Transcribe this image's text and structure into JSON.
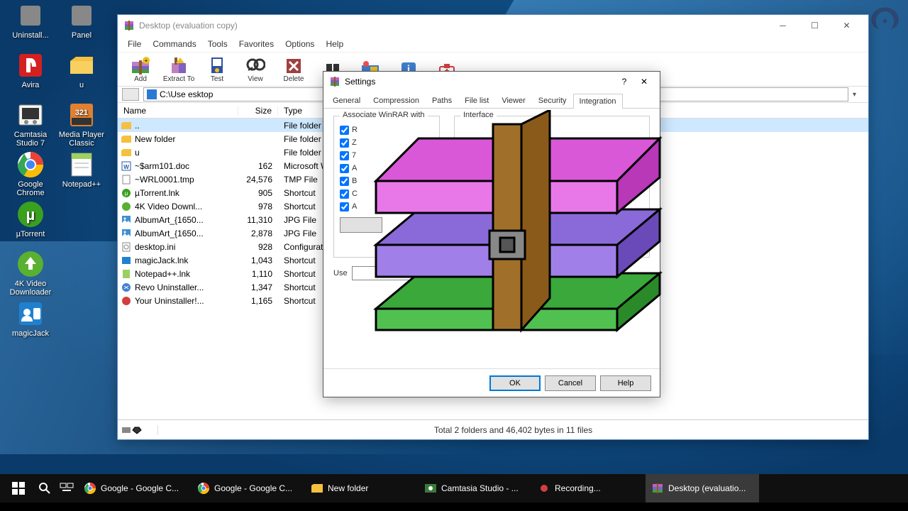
{
  "desktop": {
    "icons_col1": [
      {
        "label": "Uninstall...",
        "color": "#888"
      },
      {
        "label": "Avira",
        "color": "#d42020"
      },
      {
        "label": "Camtasia Studio 7",
        "color": "#f5f5f0"
      },
      {
        "label": "Google Chrome",
        "color": "#fff"
      },
      {
        "label": "µTorrent",
        "color": "#3aa020"
      },
      {
        "label": "4K Video Downloader",
        "color": "#5ab030"
      },
      {
        "label": "magicJack",
        "color": "#2080d0"
      }
    ],
    "icons_col2": [
      {
        "label": "Panel",
        "color": "#888"
      },
      {
        "label": "u",
        "color": "#f5c040"
      },
      {
        "label": "Media Player Classic",
        "color": "#e08030"
      },
      {
        "label": "Notepad++",
        "color": "#9dd060"
      }
    ]
  },
  "winrar": {
    "title": "Desktop (evaluation copy)",
    "menus": [
      "File",
      "Commands",
      "Tools",
      "Favorites",
      "Options",
      "Help"
    ],
    "toolbar": [
      "Add",
      "Extract To",
      "Test",
      "View",
      "Delete",
      "",
      "",
      "",
      "",
      ""
    ],
    "path": "C:\\Use            esktop",
    "columns": {
      "name": "Name",
      "size": "Size",
      "type": "Type"
    },
    "files": [
      {
        "icon": "folder-up",
        "name": "..",
        "size": "",
        "type": "File folder",
        "sel": true
      },
      {
        "icon": "folder",
        "name": "New folder",
        "size": "",
        "type": "File folder"
      },
      {
        "icon": "folder",
        "name": "u",
        "size": "",
        "type": "File folder"
      },
      {
        "icon": "doc",
        "name": "~$arm101.doc",
        "size": "162",
        "type": "Microsoft Word..."
      },
      {
        "icon": "file",
        "name": "~WRL0001.tmp",
        "size": "24,576",
        "type": "TMP File"
      },
      {
        "icon": "ut",
        "name": "µTorrent.lnk",
        "size": "905",
        "type": "Shortcut"
      },
      {
        "icon": "4k",
        "name": "4K Video Downl...",
        "size": "978",
        "type": "Shortcut"
      },
      {
        "icon": "jpg",
        "name": "AlbumArt_{1650...",
        "size": "11,310",
        "type": "JPG File"
      },
      {
        "icon": "jpg",
        "name": "AlbumArt_{1650...",
        "size": "2,878",
        "type": "JPG File"
      },
      {
        "icon": "ini",
        "name": "desktop.ini",
        "size": "928",
        "type": "Configuration s..."
      },
      {
        "icon": "mj",
        "name": "magicJack.lnk",
        "size": "1,043",
        "type": "Shortcut"
      },
      {
        "icon": "np",
        "name": "Notepad++.lnk",
        "size": "1,110",
        "type": "Shortcut"
      },
      {
        "icon": "revo",
        "name": "Revo Uninstaller...",
        "size": "1,347",
        "type": "Shortcut"
      },
      {
        "icon": "yu",
        "name": "Your Uninstaller!...",
        "size": "1,165",
        "type": "Shortcut"
      }
    ],
    "status": "Total 2 folders and 46,402 bytes in 11 files"
  },
  "settings": {
    "title": "Settings",
    "help_glyph": "?",
    "tabs": [
      "General",
      "Compression",
      "Paths",
      "File list",
      "Viewer",
      "Security",
      "Integration"
    ],
    "active_tab": 6,
    "group1_label": "Associate WinRAR with",
    "group2_label": "Interface",
    "checkboxes": [
      "R",
      "Z",
      "7",
      "A",
      "B",
      "C",
      "A"
    ],
    "user_label": "Use",
    "buttons": {
      "ok": "OK",
      "cancel": "Cancel",
      "help": "Help"
    }
  },
  "taskbar": {
    "items": [
      {
        "icon": "chrome",
        "label": "Google - Google C..."
      },
      {
        "icon": "chrome",
        "label": "Google - Google C..."
      },
      {
        "icon": "folder",
        "label": "New folder"
      },
      {
        "icon": "camtasia",
        "label": "Camtasia Studio - ..."
      },
      {
        "icon": "rec",
        "label": "Recording..."
      },
      {
        "icon": "winrar",
        "label": "Desktop (evaluatio...",
        "active": true
      }
    ]
  }
}
